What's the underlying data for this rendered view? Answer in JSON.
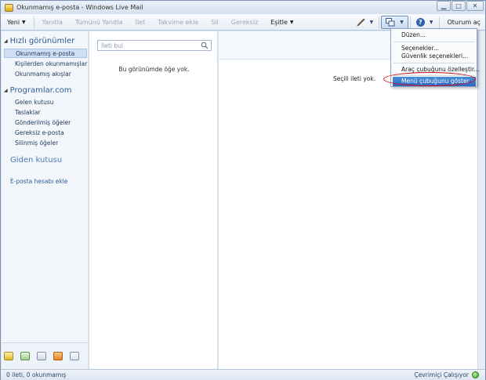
{
  "window": {
    "title": "Okunmamış e-posta - Windows Live Mail"
  },
  "toolbar": {
    "new_label": "Yeni",
    "reply_label": "Yanıtla",
    "reply_all_label": "Tümünü Yanıtla",
    "forward_label": "İlet",
    "add_to_calendar_label": "Takvime ekle",
    "delete_label": "Sil",
    "junk_label": "Gereksiz",
    "sync_label": "Eşitle",
    "sign_in_label": "Oturum aç"
  },
  "sidebar": {
    "quick_views_title": "Hızlı görünümler",
    "quick_views": [
      {
        "label": "Okunmamış e-posta",
        "selected": true
      },
      {
        "label": "Kişilerden okunmamışlar"
      },
      {
        "label": "Okunmamış akışlar"
      }
    ],
    "account_title": "Programlar.com",
    "folders": [
      {
        "label": "Gelen kutusu"
      },
      {
        "label": "Taslaklar"
      },
      {
        "label": "Gönderilmiş öğeler"
      },
      {
        "label": "Gereksiz e-posta"
      },
      {
        "label": "Silinmiş öğeler"
      }
    ],
    "outbox_title": "Giden kutusu",
    "add_account_link": "E-posta hesabı ekle"
  },
  "message_list": {
    "search_placeholder": "İleti bul",
    "empty_text": "Bu görünümde öğe yok."
  },
  "reading_pane": {
    "empty_text": "Seçili ileti yok."
  },
  "menu": {
    "items": [
      {
        "label": "Düzen..."
      },
      {
        "label": "Seçenekler..."
      },
      {
        "label": "Güvenlik seçenekleri..."
      },
      {
        "label": "Araç çubuğunu özelleştir..."
      },
      {
        "label": "Menü çubuğunu göster",
        "highlighted": true
      }
    ]
  },
  "statusbar": {
    "left_text": "0 ileti, 0 okunmamış",
    "right_text": "Çevrimiçi Çalışıyor"
  },
  "colors": {
    "accent": "#2d5d98",
    "highlight": "#2a66bf",
    "annotation": "#d0101a"
  }
}
